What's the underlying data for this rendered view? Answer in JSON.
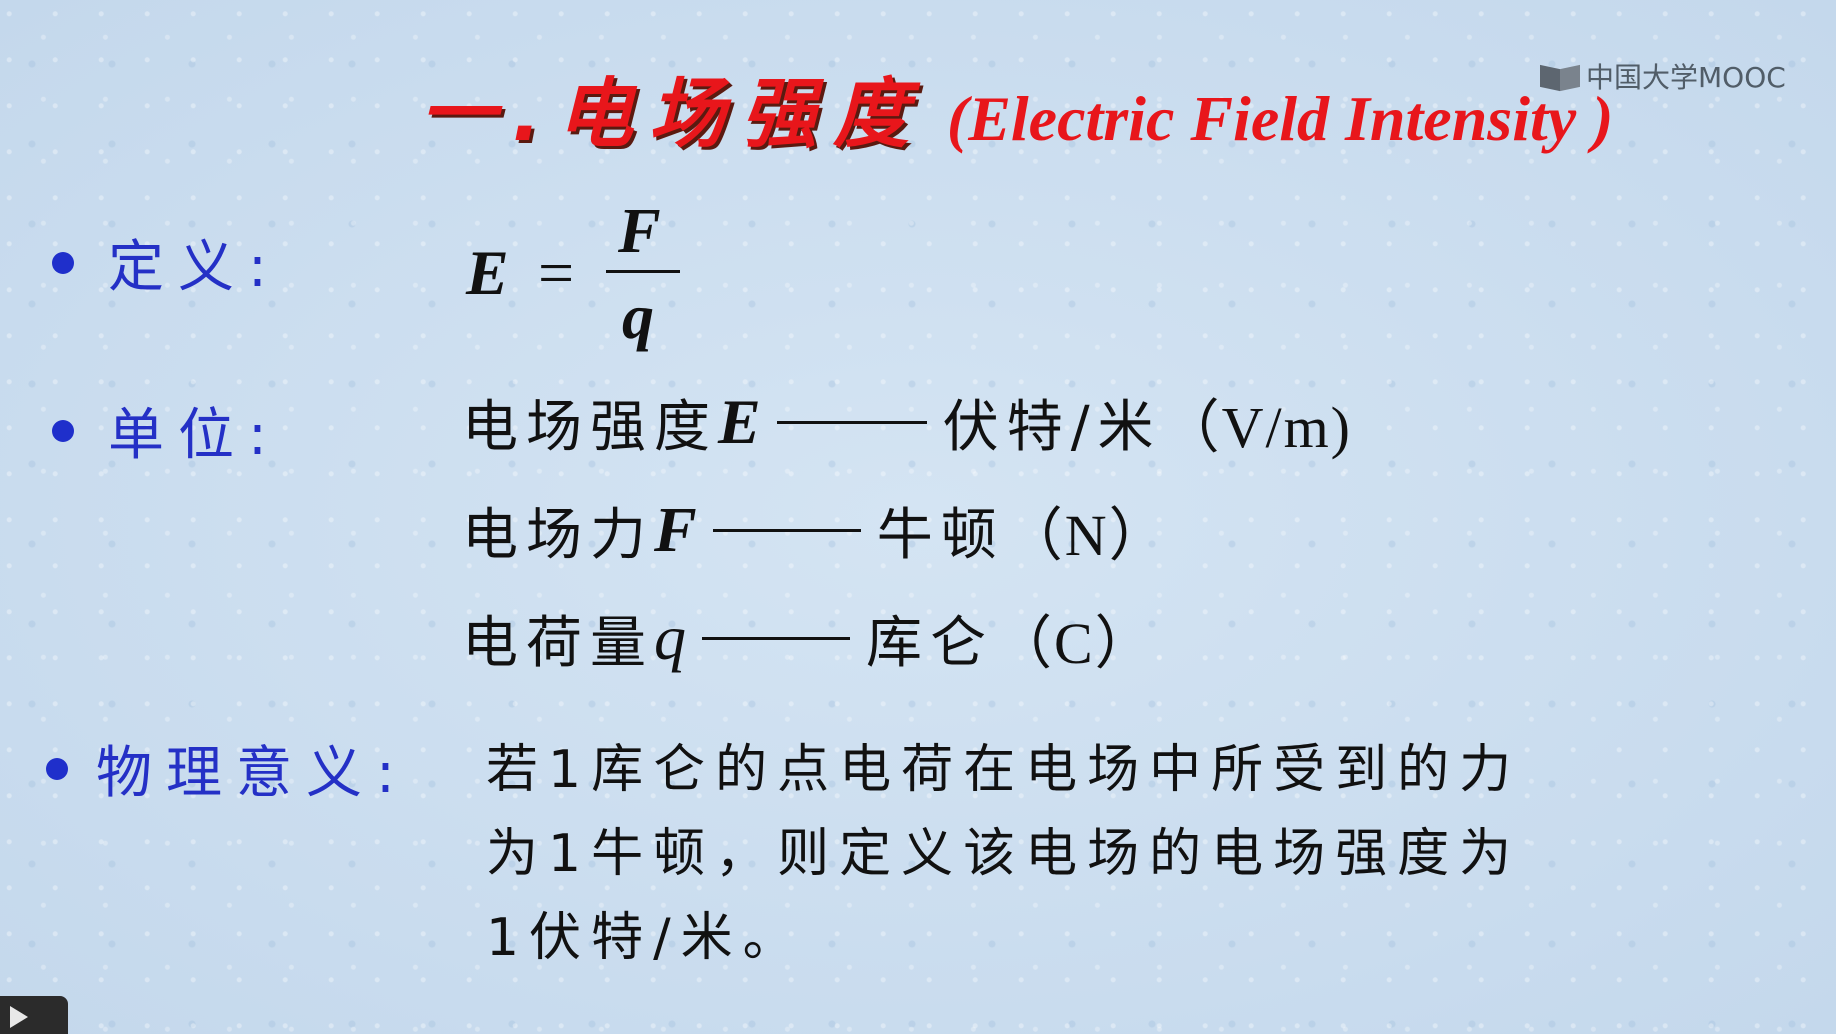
{
  "slide": {
    "title_zh": "一.电场强度",
    "title_en": "(Electric Field Intensity )",
    "watermark": "中国大学MOOC"
  },
  "definition": {
    "label": "定义:",
    "lhs": "E",
    "equals": "=",
    "numerator": "F",
    "denominator": "q"
  },
  "units": {
    "label": "单位:",
    "rows": [
      {
        "quantity": "电场强度",
        "symbol": "E",
        "unit_zh": "伏特/米",
        "unit_en": "（V/m)"
      },
      {
        "quantity": "电场力",
        "symbol": "F",
        "unit_zh": "牛顿",
        "unit_en": "（N）"
      },
      {
        "quantity": "电荷量",
        "symbol": "q",
        "unit_zh": "库仑",
        "unit_en": "（C）"
      }
    ]
  },
  "meaning": {
    "label": "物理意义:",
    "lines": [
      "若1库仑的点电荷在电场中所受到的力",
      "为1牛顿，则定义该电场的电场强度为",
      "1伏特/米。"
    ]
  },
  "colors": {
    "title": "#e8161b",
    "label": "#2430c6",
    "bullet": "#1f2fcb"
  },
  "player": {
    "control_icon": "play-icon"
  }
}
